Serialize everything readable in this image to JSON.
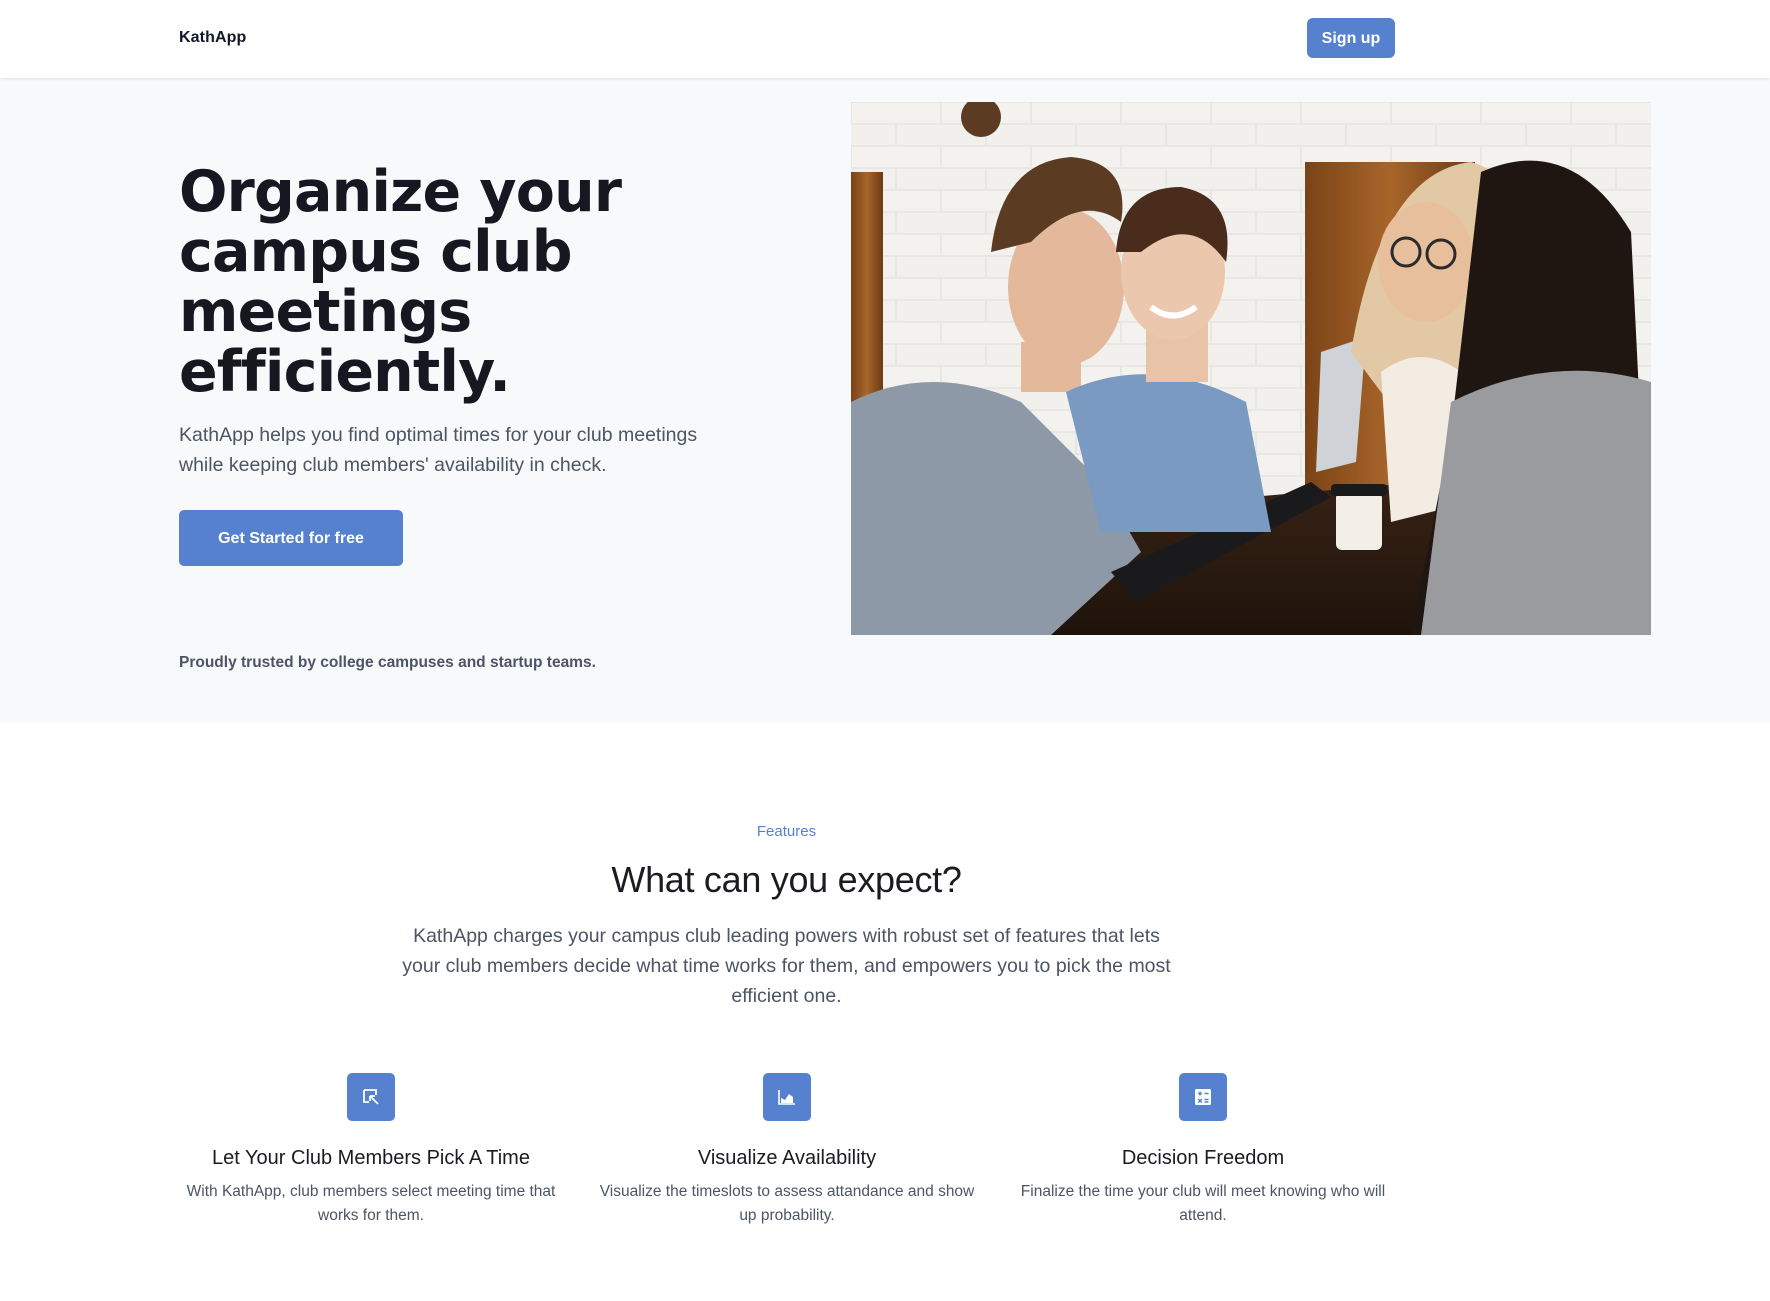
{
  "header": {
    "brand": "KathApp",
    "signup_label": "Sign up"
  },
  "hero": {
    "title": "Organize your campus club meetings efficiently.",
    "subtitle": "KathApp helps you find optimal times for your club meetings while keeping club members' availability in check.",
    "cta_label": "Get Started for free",
    "trusted_text": "Proudly trusted by college campuses and startup teams."
  },
  "features": {
    "eyebrow": "Features",
    "title": "What can you expect?",
    "subtitle": "KathApp charges your campus club leading powers with robust set of features that lets your club members decide what time works for them, and empowers you to pick the most efficient one.",
    "items": [
      {
        "icon": "cursor-select-icon",
        "title": "Let Your Club Members Pick A Time",
        "description": "With KathApp, club members select meeting time that works for them."
      },
      {
        "icon": "area-chart-icon",
        "title": "Visualize Availability",
        "description": "Visualize the timeslots to assess attandance and show up probability."
      },
      {
        "icon": "calculator-icon",
        "title": "Decision Freedom",
        "description": "Finalize the time your club will meet knowing who will attend."
      }
    ]
  },
  "colors": {
    "accent": "#5581cf",
    "hero_bg": "#f8f9fb",
    "heading": "#161821",
    "body_text": "#4b5563"
  }
}
